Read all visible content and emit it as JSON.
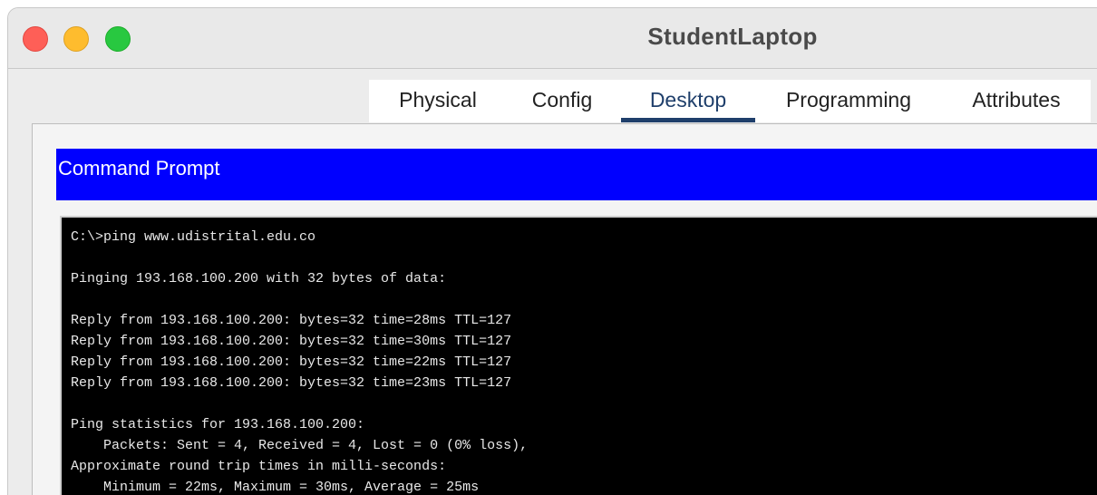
{
  "window": {
    "title": "StudentLaptop"
  },
  "tabs": [
    {
      "label": "Physical"
    },
    {
      "label": "Config"
    },
    {
      "label": "Desktop",
      "active": true
    },
    {
      "label": "Programming"
    },
    {
      "label": "Attributes"
    }
  ],
  "command_prompt": {
    "header": "Command Prompt",
    "lines": [
      "C:\\>ping www.udistrital.edu.co",
      "",
      "Pinging 193.168.100.200 with 32 bytes of data:",
      "",
      "Reply from 193.168.100.200: bytes=32 time=28ms TTL=127",
      "Reply from 193.168.100.200: bytes=32 time=30ms TTL=127",
      "Reply from 193.168.100.200: bytes=32 time=22ms TTL=127",
      "Reply from 193.168.100.200: bytes=32 time=23ms TTL=127",
      "",
      "Ping statistics for 193.168.100.200:",
      "    Packets: Sent = 4, Received = 4, Lost = 0 (0% loss),",
      "Approximate round trip times in milli-seconds:",
      "    Minimum = 22ms, Maximum = 30ms, Average = 25ms"
    ]
  },
  "colors": {
    "header_bar": "#0000ff",
    "terminal_bg": "#000000",
    "active_tab": "#1f3f6b"
  }
}
